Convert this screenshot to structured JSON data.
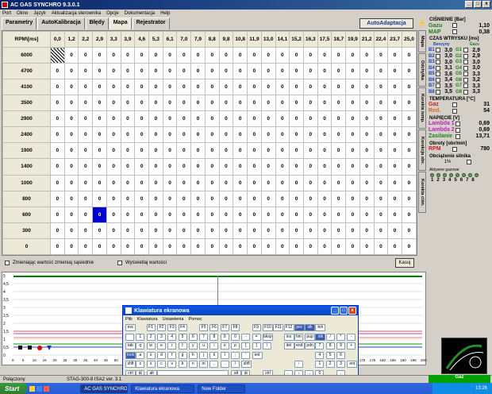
{
  "window": {
    "title": "AC GAS SYNCHRO 9.3.0.1",
    "min": "_",
    "max": "□",
    "close": "x"
  },
  "menu": [
    "Port",
    "Okno",
    "Język",
    "Aktualizacja sterownika",
    "Opcje",
    "Dokumentacja",
    "Help"
  ],
  "tabs": [
    "Parametry",
    "AutoKalibracja",
    "Błędy",
    "Mapa",
    "Rejestrator"
  ],
  "active_tab": "Mapa",
  "autoadapt_label": "AutoAdaptacja",
  "map": {
    "corner": "RPM\\[ms]",
    "cols": [
      "0,0",
      "1,2",
      "2,2",
      "2,9",
      "3,3",
      "3,9",
      "4,6",
      "5,3",
      "6,1",
      "7,0",
      "7,9",
      "8,8",
      "9,8",
      "10,8",
      "11,9",
      "13,0",
      "14,1",
      "15,2",
      "16,3",
      "17,5",
      "18,7",
      "19,9",
      "21,2",
      "22,4",
      "23,7",
      "25,0"
    ],
    "rows": [
      "6000",
      "4700",
      "4100",
      "3500",
      "2900",
      "2400",
      "1900",
      "1400",
      "1000",
      "800",
      "600",
      "300",
      "0"
    ],
    "cell_value": "0",
    "hatched_cell": {
      "row": 0,
      "col": 0
    },
    "selected_cell": {
      "row": 10,
      "col": 3
    }
  },
  "side_tabs": [
    "Mapa",
    "Odchyłka",
    "Korekta temp.",
    "Korekta ciśn.",
    "Korekcja obr."
  ],
  "panel": {
    "pressure_title": "CIŚNIENIE [Bar]",
    "pressure": [
      {
        "label": "Gazu",
        "value": "1,10",
        "color": "#208020"
      },
      {
        "label": "MAP",
        "value": "0,38",
        "color": "#208020"
      }
    ],
    "inj_title": "CZAS WTRYSKU [ms]",
    "inj_header": [
      "Benzyny",
      "Gazu"
    ],
    "injectors": [
      {
        "b": "B1",
        "bv": "3,0",
        "g": "G1",
        "gv": "2,9"
      },
      {
        "b": "B2",
        "bv": "3,0",
        "g": "G2",
        "gv": "2,9"
      },
      {
        "b": "B3",
        "bv": "3,0",
        "g": "G3",
        "gv": "3,0"
      },
      {
        "b": "B4",
        "bv": "3,1",
        "g": "G4",
        "gv": "3,0"
      },
      {
        "b": "B5",
        "bv": "3,6",
        "g": "G5",
        "gv": "3,3"
      },
      {
        "b": "B6",
        "bv": "3,4",
        "g": "G6",
        "gv": "3,2"
      },
      {
        "b": "B7",
        "bv": "3,5",
        "g": "G7",
        "gv": "3,3"
      },
      {
        "b": "B8",
        "bv": "3,5",
        "g": "G8",
        "gv": "3,3"
      }
    ],
    "temp_title": "TEMPERATURA [°C]",
    "temps": [
      {
        "label": "Gaz",
        "value": "31",
        "color": "#c02020"
      },
      {
        "label": "Red.",
        "value": "54",
        "color": "#e06020"
      }
    ],
    "volt_title": "NAPIĘCIE [V]",
    "volts": [
      {
        "label": "Lambda 1",
        "value": "0,69",
        "color": "#c020c0"
      },
      {
        "label": "Lambda 2",
        "value": "0,69",
        "color": "#c020c0"
      },
      {
        "label": "Zasilanie",
        "value": "13,71",
        "color": "#208020"
      }
    ],
    "rpm_title": "Obroty [obr/min]",
    "rpm": {
      "label": "RPM",
      "value": "780",
      "color": "#c02020"
    },
    "load_title": "Obciążenie silnika",
    "load_value": "1%",
    "active_inj_title": "Aktywne gazowe",
    "active_inj": [
      "1",
      "2",
      "3",
      "4",
      "5",
      "6",
      "7",
      "8"
    ]
  },
  "options": {
    "opt1": "Zmieniając wartość zmieniaj sąsiednie",
    "opt2": "Wyświetlaj wartości",
    "kasuj": "Kasuj"
  },
  "plot": {
    "y_ticks": [
      "5",
      "4,5",
      "4",
      "3,5",
      "3",
      "2,5",
      "2",
      "1,5",
      "1",
      "0,5",
      "0"
    ],
    "x_ticks": [
      "0",
      "5",
      "10",
      "15",
      "20",
      "25",
      "30",
      "35",
      "40",
      "45",
      "50",
      "55",
      "60",
      "65",
      "70",
      "75",
      "80",
      "85",
      "90",
      "95",
      "100",
      "105",
      "110",
      "115",
      "120",
      "125",
      "130",
      "135",
      "140",
      "145",
      "150",
      "155",
      "160",
      "165",
      "170",
      "175",
      "180",
      "185",
      "190",
      "195",
      "200"
    ]
  },
  "status": {
    "left": "Połączony",
    "mid": "STAG-300-8 ISA2  ver. 3.1",
    "gaz": "Gaz"
  },
  "osk": {
    "title": "Klawiatura ekranowa",
    "menu": [
      "Plik",
      "Klawiatura",
      "Ustawienia",
      "Pomoc"
    ]
  },
  "taskbar": {
    "start": "Start",
    "tasks": [
      "AC GAS SYNCHRO",
      "Klawiatura ekranowa",
      "New Folder"
    ],
    "clock": "13:26"
  }
}
